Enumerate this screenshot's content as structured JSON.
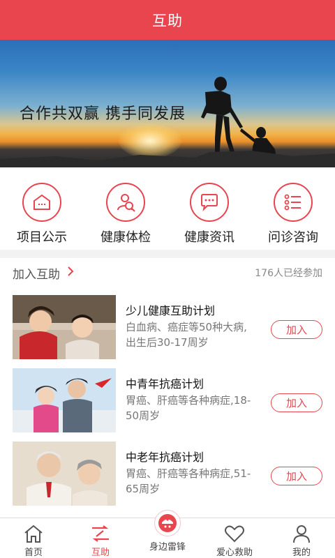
{
  "header": {
    "title": "互助"
  },
  "banner": {
    "slogan": "合作共双赢 携手同发展"
  },
  "quick_menu": [
    {
      "label": "项目公示",
      "icon": "house-icon"
    },
    {
      "label": "健康体检",
      "icon": "health-check-icon"
    },
    {
      "label": "健康资讯",
      "icon": "chat-bubble-icon"
    },
    {
      "label": "问诊咨询",
      "icon": "list-icon"
    }
  ],
  "join_section": {
    "title": "加入互助",
    "count": "176人已经参加"
  },
  "plans": [
    {
      "title": "少儿健康互助计划",
      "desc": "白血病、癌症等50种大病,出生后30-17周岁",
      "button": "加入"
    },
    {
      "title": "中青年抗癌计划",
      "desc": "胃癌、肝癌等各种病症,18-50周岁",
      "button": "加入"
    },
    {
      "title": "中老年抗癌计划",
      "desc": "胃癌、肝癌等各种病症,51-65周岁",
      "button": "加入"
    }
  ],
  "tabbar": {
    "items": [
      {
        "label": "首页",
        "icon": "home-icon"
      },
      {
        "label": "互助",
        "icon": "mutual-aid-icon"
      },
      {
        "label": "身边雷锋",
        "icon": "leifeng-icon"
      },
      {
        "label": "爱心救助",
        "icon": "heart-icon"
      },
      {
        "label": "我的",
        "icon": "user-icon"
      }
    ],
    "active": "互助"
  },
  "colors": {
    "accent": "#e8454f"
  }
}
